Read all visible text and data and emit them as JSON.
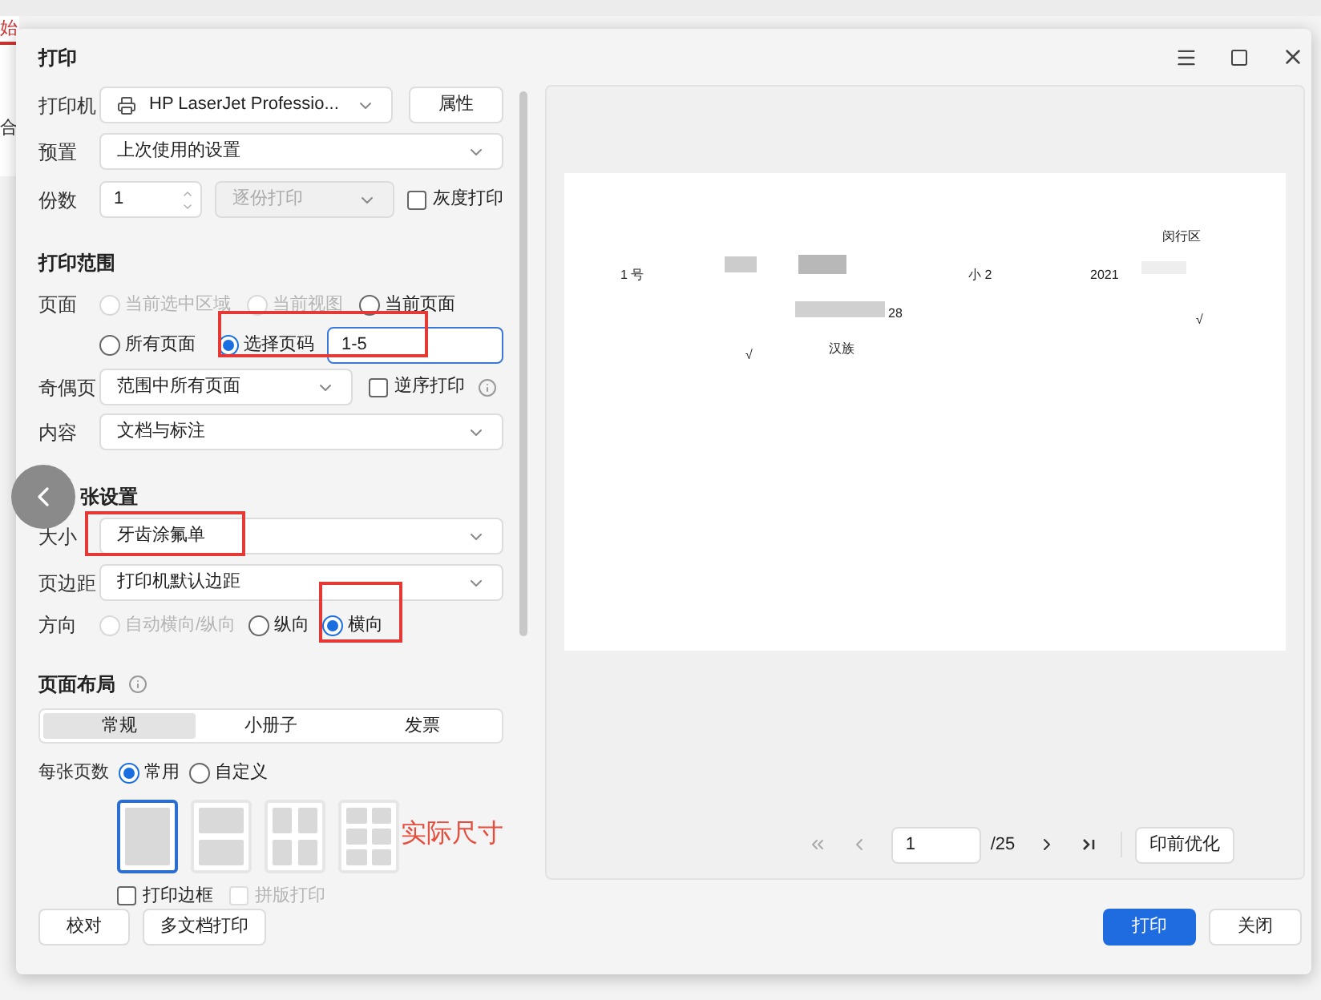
{
  "background": {
    "tab": "始",
    "item": "合"
  },
  "dialog": {
    "title": "打印"
  },
  "printer": {
    "label": "打印机",
    "value": "HP LaserJet Professio...",
    "button": "属性"
  },
  "preset": {
    "label": "预置",
    "value": "上次使用的设置"
  },
  "copies": {
    "label": "份数",
    "value": "1",
    "collate": {
      "value": "逐份打印",
      "disabled": true
    },
    "grayscale": {
      "label": "灰度打印",
      "checked": false
    }
  },
  "print_range": {
    "title": "打印范围",
    "pages_label": "页面",
    "options": [
      {
        "label": "当前选中区域",
        "selected": false,
        "disabled": true
      },
      {
        "label": "当前视图",
        "selected": false,
        "disabled": true
      },
      {
        "label": "当前页面",
        "selected": false,
        "disabled": false
      },
      {
        "label": "所有页面",
        "selected": false,
        "disabled": false
      },
      {
        "label": "选择页码",
        "selected": true,
        "disabled": false
      }
    ],
    "page_input": "1-5",
    "odd_even": {
      "label": "奇偶页",
      "value": "范围中所有页面"
    },
    "reverse": {
      "label": "逆序打印",
      "checked": false
    },
    "content": {
      "label": "内容",
      "value": "文档与标注"
    }
  },
  "paper": {
    "title": "张设置",
    "size": {
      "label": "大小",
      "value": "牙齿涂氟单"
    },
    "margin": {
      "label": "页边距",
      "value": "打印机默认边距"
    },
    "orientation": {
      "label": "方向",
      "options": [
        {
          "label": "自动横向/纵向",
          "selected": false,
          "disabled": true
        },
        {
          "label": "纵向",
          "selected": false,
          "disabled": false
        },
        {
          "label": "横向",
          "selected": true,
          "disabled": false
        }
      ]
    }
  },
  "layout": {
    "title": "页面布局",
    "tabs": [
      {
        "label": "常规",
        "selected": true
      },
      {
        "label": "小册子",
        "selected": false
      },
      {
        "label": "发票",
        "selected": false
      }
    ],
    "per_sheet": {
      "label": "每张页数",
      "options": [
        {
          "label": "常用",
          "selected": true
        },
        {
          "label": "自定义",
          "selected": false
        }
      ],
      "thumbnails": [
        {
          "kind": "one",
          "selected": true
        },
        {
          "kind": "two",
          "selected": false
        },
        {
          "kind": "four",
          "selected": false
        },
        {
          "kind": "six",
          "selected": false
        }
      ]
    },
    "checkboxes": [
      {
        "label": "打印边框",
        "checked": false,
        "disabled": false
      },
      {
        "label": "拼版打印",
        "checked": false,
        "disabled": true
      }
    ]
  },
  "annotation": "实际尺寸",
  "preview": {
    "texts": [
      "闵行区",
      "1 号",
      "小 2",
      "2021",
      "28",
      "√",
      "汉族",
      "√"
    ],
    "nav": {
      "page": "1",
      "total": "/25",
      "button": "印前优化"
    }
  },
  "footer": {
    "left_buttons": [
      "校对",
      "多文档打印"
    ],
    "print": "打印",
    "close": "关闭"
  }
}
